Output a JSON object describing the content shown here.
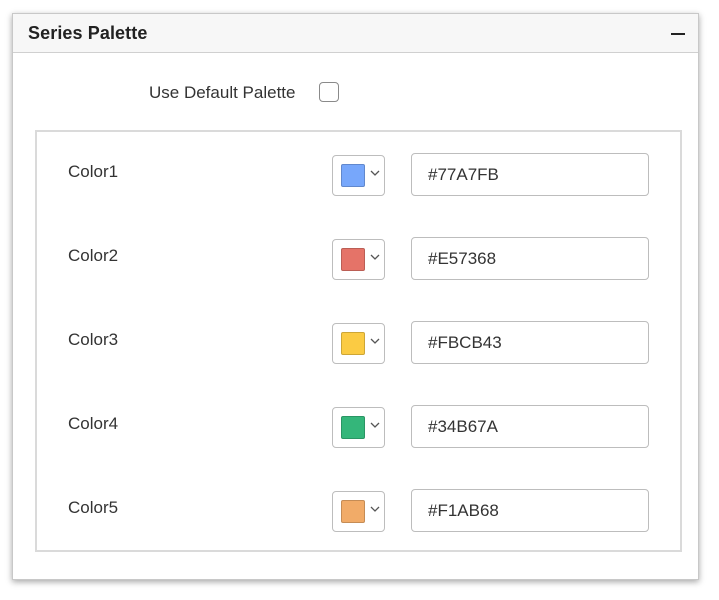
{
  "panel": {
    "title": "Series Palette",
    "collapse_icon": "minus-icon"
  },
  "default_palette": {
    "label": "Use Default Palette",
    "checked": false
  },
  "colors": [
    {
      "label": "Color1",
      "hex": "#77A7FB",
      "swatch": "#77A7FB"
    },
    {
      "label": "Color2",
      "hex": "#E57368",
      "swatch": "#E57368"
    },
    {
      "label": "Color3",
      "hex": "#FBCB43",
      "swatch": "#FBCB43"
    },
    {
      "label": "Color4",
      "hex": "#34B67A",
      "swatch": "#34B67A"
    },
    {
      "label": "Color5",
      "hex": "#F1AB68",
      "swatch": "#F1AB68"
    }
  ],
  "icons": {
    "picker_dropdown": "chevron-down-icon"
  }
}
